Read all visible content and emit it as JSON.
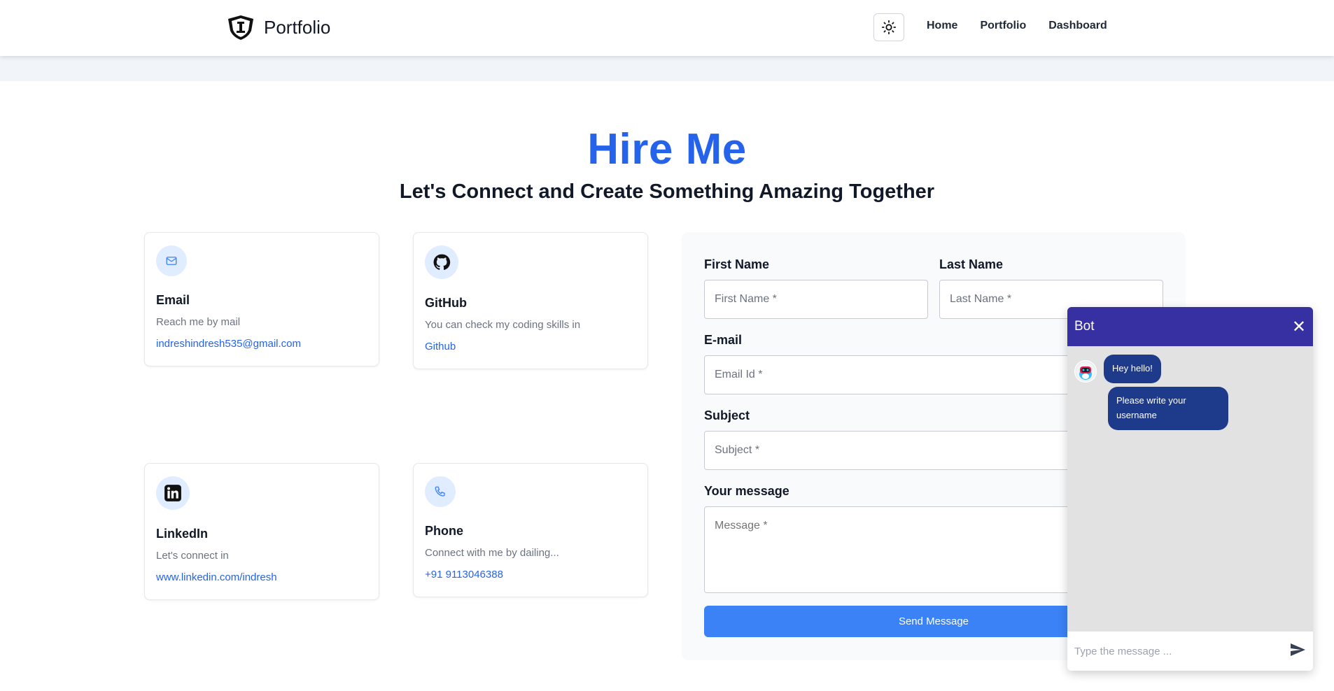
{
  "nav": {
    "brand": "Portfolio",
    "links": [
      "Home",
      "Portfolio",
      "Dashboard"
    ]
  },
  "hero": {
    "title": "Hire Me",
    "subtitle": "Let's Connect and Create Something Amazing Together"
  },
  "cards": {
    "email": {
      "title": "Email",
      "desc": "Reach me by mail",
      "link": "indreshindresh535@gmail.com"
    },
    "github": {
      "title": "GitHub",
      "desc": "You can check my coding skills in",
      "link": "Github"
    },
    "linkedin": {
      "title": "LinkedIn",
      "desc": "Let's connect in",
      "link": "www.linkedin.com/indresh"
    },
    "phone": {
      "title": "Phone",
      "desc": "Connect with me by dailing...",
      "link": "+91 9113046388"
    }
  },
  "form": {
    "first_name_label": "First Name",
    "first_name_placeholder": "First Name *",
    "last_name_label": "Last Name",
    "last_name_placeholder": "Last Name *",
    "email_label": "E-mail",
    "email_placeholder": "Email Id *",
    "subject_label": "Subject",
    "subject_placeholder": "Subject *",
    "message_label": "Your message",
    "message_placeholder": "Message *",
    "send_label": "Send Message"
  },
  "bot": {
    "title": "Bot",
    "close": "✕",
    "messages": [
      "Hey hello!",
      "Please write your username"
    ],
    "input_placeholder": "Type the message ..."
  },
  "colors": {
    "accent": "#2563eb",
    "button": "#3b82f6",
    "bot_header": "#3730a3",
    "bubble": "#1e3a8a"
  }
}
